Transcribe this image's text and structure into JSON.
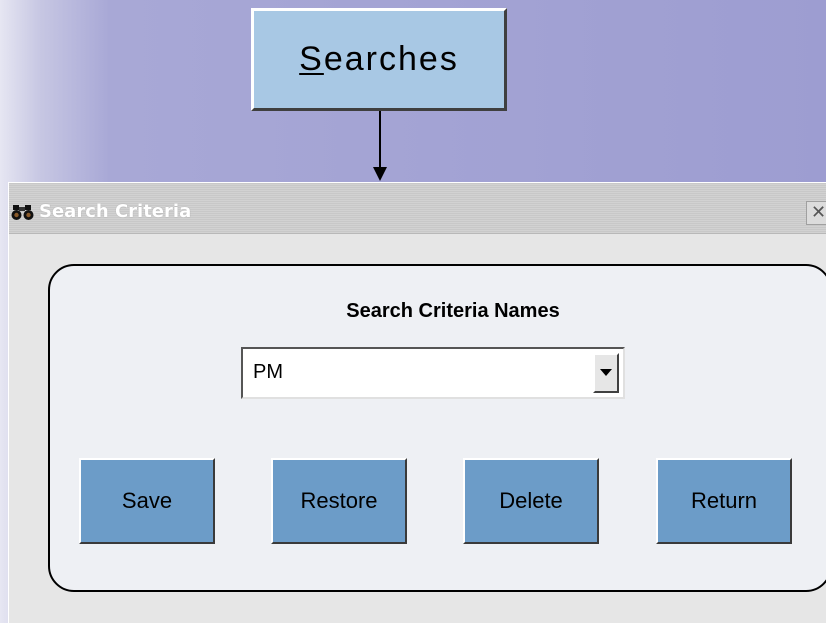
{
  "top_button": {
    "label_mnemonic": "S",
    "label_rest": "earches"
  },
  "dialog": {
    "title": "Search Criteria",
    "close_glyph": "✕",
    "icon": "binoculars-icon"
  },
  "panel": {
    "heading": "Search Criteria Names",
    "dropdown": {
      "selected": "PM"
    },
    "buttons": {
      "save": "Save",
      "restore": "Restore",
      "delete": "Delete",
      "return": "Return"
    }
  },
  "colors": {
    "top_button_bg": "#a8c8e4",
    "action_button_bg": "#6c9cc8",
    "background": "#9d9dd1"
  }
}
